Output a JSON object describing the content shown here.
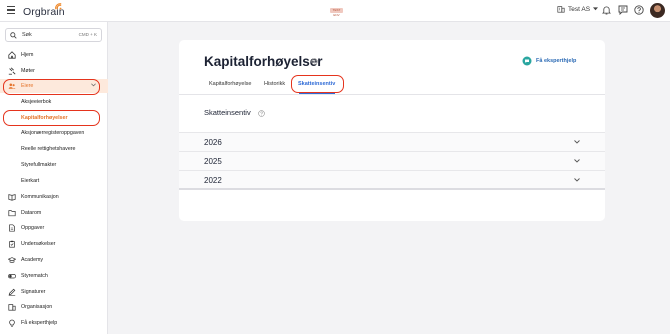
{
  "header": {
    "brand": "Orgbrain",
    "env_badge": "TEST ENV",
    "company": "Test AS"
  },
  "sidebar": {
    "search_label": "Søk",
    "search_shortcut": "CMD + K",
    "items": [
      {
        "label": "Hjem",
        "icon": "home-icon"
      },
      {
        "label": "Møter",
        "icon": "gavel-icon"
      },
      {
        "label": "Eiere",
        "icon": "users-icon"
      },
      {
        "label": "Aksjeeierbok",
        "icon": ""
      },
      {
        "label": "Kapitalforhøyelser",
        "icon": ""
      },
      {
        "label": "Aksjonærregisteroppgaven",
        "icon": ""
      },
      {
        "label": "Reelle rettighetshavere",
        "icon": ""
      },
      {
        "label": "Styrefullmakter",
        "icon": ""
      },
      {
        "label": "Eierkart",
        "icon": ""
      },
      {
        "label": "Kommunikasjon",
        "icon": "book-icon"
      },
      {
        "label": "Datarom",
        "icon": "folder-icon"
      },
      {
        "label": "Oppgaver",
        "icon": "document-icon"
      },
      {
        "label": "Undersøkelser",
        "icon": "clipboard-icon"
      },
      {
        "label": "Academy",
        "icon": "graduation-cap-icon"
      },
      {
        "label": "Styrematch",
        "icon": "toggle-icon"
      },
      {
        "label": "Signaturer",
        "icon": "pen-icon"
      },
      {
        "label": "Organisasjon",
        "icon": "building-icon"
      },
      {
        "label": "Få eksperthjelp",
        "icon": "lightbulb-icon"
      }
    ]
  },
  "main": {
    "title": "Kapitalforhøyelser",
    "expert_help": "Få eksperthjelp",
    "tabs": [
      {
        "label": "Kapitalforhøyelse"
      },
      {
        "label": "Historikk"
      },
      {
        "label": "Skatteinsentiv"
      }
    ],
    "active_tab": "Skatteinsentiv",
    "section_title": "Skatteinsentiv",
    "years": [
      "2026",
      "2025",
      "2022"
    ]
  },
  "colors": {
    "accent_orange": "#e5732a",
    "active_blue": "#2f6bd6",
    "annotation_red": "#e5341d"
  }
}
